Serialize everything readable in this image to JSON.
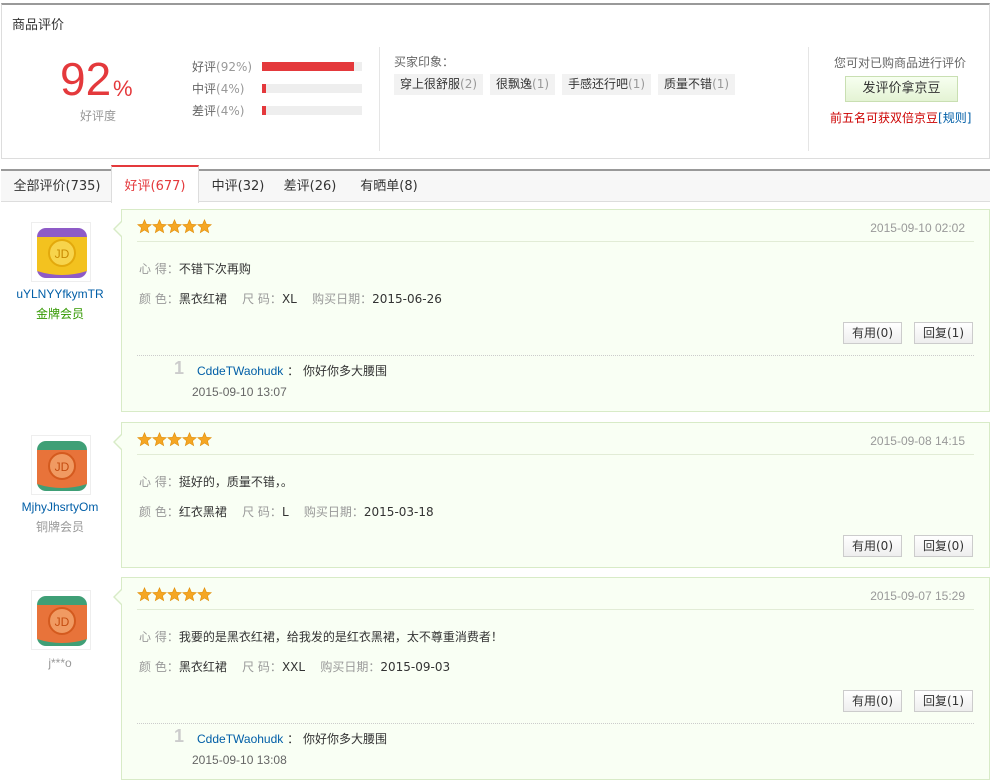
{
  "summary": {
    "title": "商品评价",
    "rate_number": "92",
    "rate_symbol": "%",
    "rate_label": "好评度",
    "bars": [
      {
        "label": "好评",
        "pct_text": "(92%)",
        "fraction": 0.92
      },
      {
        "label": "中评",
        "pct_text": "(4%)",
        "fraction": 0.04
      },
      {
        "label": "差评",
        "pct_text": "(4%)",
        "fraction": 0.04
      }
    ],
    "impressions_title": "买家印象：",
    "tags": [
      {
        "text": "穿上很舒服",
        "count": "(2)"
      },
      {
        "text": "很飘逸",
        "count": "(1)"
      },
      {
        "text": "手感还行吧",
        "count": "(1)"
      },
      {
        "text": "质量不错",
        "count": "(1)"
      }
    ],
    "prompt": "您可对已购商品进行评价",
    "review_button": "发评价拿京豆",
    "bonus_text": "前五名可获双倍京豆",
    "rules_link": "[规则]",
    "colors": {
      "accent": "#e4393c",
      "link": "#005ea7"
    }
  },
  "tabs": [
    {
      "label": "全部评价(735)"
    },
    {
      "label": "好评(677)",
      "active": true
    },
    {
      "label": "中评(32)"
    },
    {
      "label": "差评(26)"
    },
    {
      "label": "有晒单(8)"
    }
  ],
  "reviews": [
    {
      "user": {
        "name": "uYLNYYfkymTR",
        "level": "金牌会员",
        "avatar_icon": "gold-jd-avatar-icon"
      },
      "stars": 5,
      "date": "2015-09-10 02:02",
      "heart_key": "心    得：",
      "heart": "不错下次再购",
      "color_key": "颜    色：",
      "color": "黑衣红裙",
      "size_key": "尺    码：",
      "size": "XL",
      "buy_key": "购买日期：",
      "buy_date": "2015-06-26",
      "useful": "有用(0)",
      "reply": "回复(1)",
      "replies": [
        {
          "num": "1",
          "user": "CddeTWaohudk",
          "sep": "：",
          "text": "你好你多大腰围",
          "date": "2015-09-10 13:07"
        }
      ]
    },
    {
      "user": {
        "name": "MjhyJhsrtyOm",
        "level": "铜牌会员",
        "avatar_icon": "copper-jd-avatar-icon"
      },
      "stars": 5,
      "date": "2015-09-08 14:15",
      "heart_key": "心    得：",
      "heart": "挺好的，质量不错，。",
      "color_key": "颜    色：",
      "color": "红衣黑裙",
      "size_key": "尺    码：",
      "size": "L",
      "buy_key": "购买日期：",
      "buy_date": "2015-03-18",
      "useful": "有用(0)",
      "reply": "回复(0)",
      "replies": []
    },
    {
      "user": {
        "name": "j***o",
        "level": "",
        "avatar_icon": "copper-jd-avatar-icon"
      },
      "stars": 5,
      "date": "2015-09-07 15:29",
      "heart_key": "心    得：",
      "heart": "我要的是黑衣红裙，给我发的是红衣黑裙，太不尊重消费者！",
      "color_key": "颜    色：",
      "color": "黑衣红裙",
      "size_key": "尺    码：",
      "size": "XXL",
      "buy_key": "购买日期：",
      "buy_date": "2015-09-03",
      "useful": "有用(0)",
      "reply": "回复(1)",
      "replies": [
        {
          "num": "1",
          "user": "CddeTWaohudk",
          "sep": "：",
          "text": "你好你多大腰围",
          "date": "2015-09-10 13:08"
        }
      ]
    }
  ]
}
